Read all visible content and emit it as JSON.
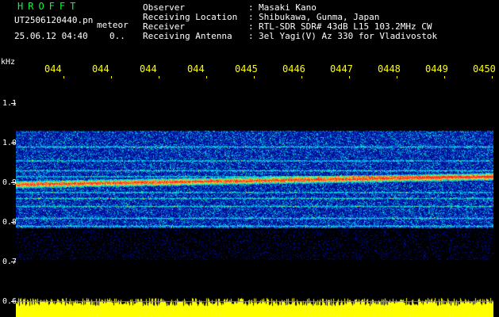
{
  "header": {
    "brand": "HROFFT",
    "filename": "UT2506120440.pn",
    "mode": "meteor",
    "datetime": "25.06.12 04:40",
    "frac": "0..",
    "fields": [
      {
        "label": "Observer",
        "value": "Masaki Kano"
      },
      {
        "label": "Receiving Location",
        "value": "Shibukawa, Gunma, Japan"
      },
      {
        "label": "Receiver",
        "value": "RTL-SDR SDR# 43dB L15 103.2MHz CW"
      },
      {
        "label": "Receiving Antenna",
        "value": "3el Yagi(V) Az 330 for Vladivostok"
      }
    ]
  },
  "axis": {
    "unit": "kHz",
    "freq_labels": [
      "1.1",
      "1.0",
      "0.9",
      "0.8",
      "0.7",
      "0.6"
    ],
    "time_labels": [
      "044",
      "044",
      "044",
      "044",
      "0445",
      "0446",
      "0447",
      "0448",
      "0449",
      "0450"
    ]
  },
  "colors": {
    "background": "#000000",
    "text": "#ffffff",
    "time_labels": "#ffff00",
    "brand": "#00ff33",
    "noise_strip": "#ffff00",
    "signal_band": "#ff3030"
  },
  "signal": {
    "noise_band_khz": [
      0.785,
      1.03
    ],
    "carrier_khz": 0.895,
    "secondary_lines_khz": [
      0.99,
      0.955,
      0.93,
      0.915,
      0.875,
      0.86,
      0.84,
      0.81,
      0.79
    ]
  }
}
